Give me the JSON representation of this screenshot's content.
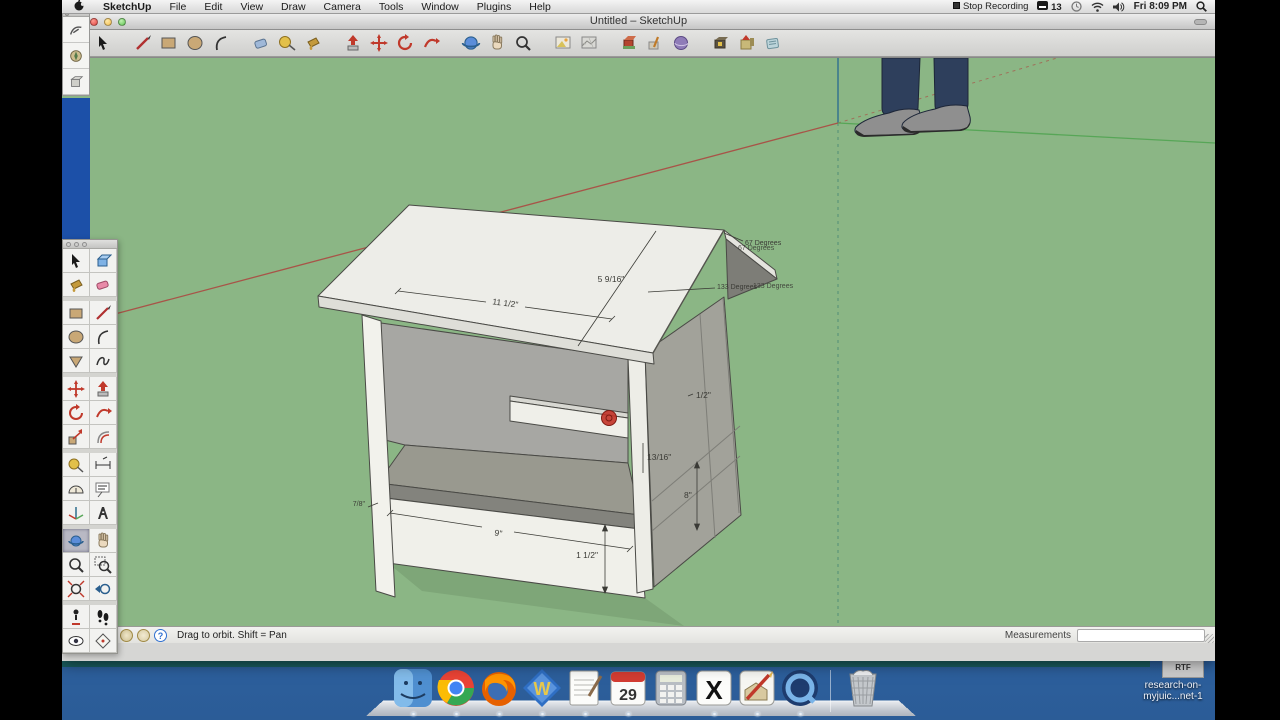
{
  "menu_bar": {
    "items": [
      "SketchUp",
      "File",
      "Edit",
      "View",
      "Draw",
      "Camera",
      "Tools",
      "Window",
      "Plugins",
      "Help"
    ],
    "apple_icon": "apple-logo",
    "status_items": {
      "stop_recording": "Stop Recording",
      "input_count": "13",
      "datetime": "Fri 8:09 PM"
    }
  },
  "window": {
    "title": "Untitled – SketchUp"
  },
  "toolbar_icons": [
    "select",
    "line",
    "rectangle",
    "circle",
    "arc",
    "eraser",
    "tape-measure",
    "paint-bucket",
    "push-pull",
    "move",
    "rotate",
    "follow-me",
    "orbit",
    "pan",
    "zoom",
    "add-location",
    "toggle-terrain",
    "photo-textures",
    "match-photo",
    "preview-model",
    "get-models",
    "share-model",
    "model-info"
  ],
  "tool_palette_icons": [
    "select",
    "make-component",
    "paint-bucket",
    "eraser",
    "rectangle",
    "line",
    "circle",
    "arc",
    "polygon",
    "freehand",
    "move",
    "push-pull",
    "rotate",
    "follow-me",
    "scale",
    "offset",
    "tape-measure",
    "dimension",
    "protractor",
    "text",
    "axes",
    "3d-text",
    "orbit",
    "pan",
    "zoom",
    "zoom-window",
    "zoom-extents",
    "previous",
    "position-camera",
    "walk",
    "look-around",
    "section-plane"
  ],
  "selected_tool": "orbit",
  "viewport": {
    "annotations": {
      "roof_width": "11 1/2\"",
      "roof_slope": "5 9/16\"",
      "angle_peak_a": "67 Degrees",
      "angle_peak_b": "67 Degrees",
      "angle_eave_a": "133 Degrees",
      "angle_eave_b": "133 Degrees",
      "overhang": "1/2\"",
      "board_thickness": "13/16\"",
      "side_height": "8\"",
      "base_width": "9\"",
      "base_height": "1 1/2\"",
      "front_lip": "7/8\""
    },
    "colors": {
      "background_green": "#8bb685",
      "axis_red": "#a85448",
      "axis_green": "#57a657",
      "axis_blue": "#2e6e8e",
      "marker_red": "#c23227"
    }
  },
  "status_bar": {
    "help_glyph": "?",
    "hint": "Drag to orbit.  Shift = Pan",
    "measurements_label": "Measurements",
    "measurements_value": ""
  },
  "dock": {
    "icons": [
      "finder",
      "chrome",
      "firefox",
      "w-app",
      "textedit",
      "ical",
      "calculator",
      "x11",
      "sketchup",
      "quicktime",
      "trash"
    ],
    "w_app_letter": "W",
    "ical_day": "29",
    "x11_letter": "X"
  },
  "desktop": {
    "file_badge": "RTF",
    "file_label_line1": "research-on-",
    "file_label_line2": "myjuic...net-1"
  }
}
